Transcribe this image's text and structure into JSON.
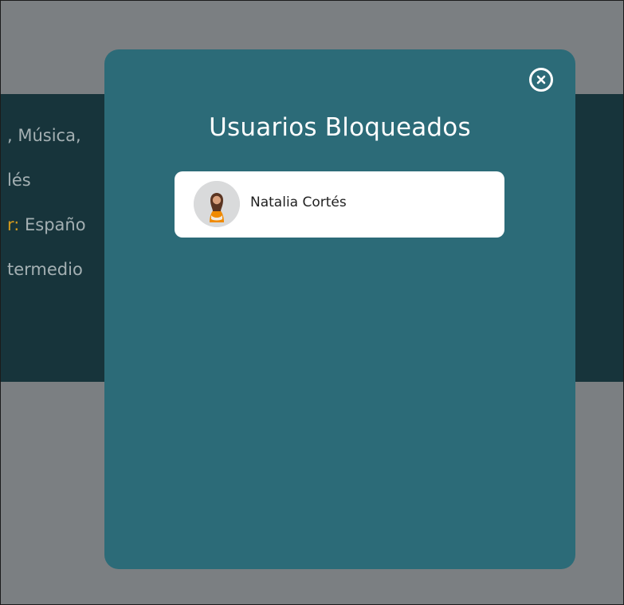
{
  "background": {
    "lines": [
      {
        "prefix": "",
        "text": ", Música,"
      },
      {
        "prefix": "",
        "text": "lés"
      },
      {
        "prefix": "r:",
        "text": " Españo"
      },
      {
        "prefix": "",
        "text": "termedio"
      }
    ]
  },
  "modal": {
    "title": "Usuarios Bloqueados",
    "users": [
      {
        "name": "Natalia Cortés"
      }
    ]
  },
  "colors": {
    "overlay": "#7b7f82",
    "background_band": "#17343b",
    "modal": "#2c6b78",
    "card": "#ffffff",
    "accent": "#d39a1d"
  },
  "icons": {
    "close": "close-icon",
    "avatar": "avatar"
  }
}
